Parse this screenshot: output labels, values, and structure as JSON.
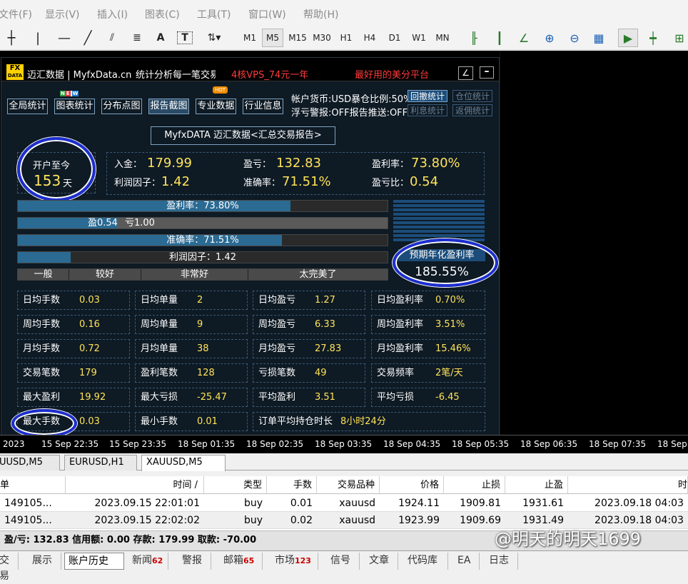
{
  "menu": [
    "文件(F)",
    "显示(V)",
    "插入(I)",
    "图表(C)",
    "工具(T)",
    "窗口(W)",
    "帮助(H)"
  ],
  "timeframes": [
    "M1",
    "M5",
    "M15",
    "M30",
    "H1",
    "H4",
    "D1",
    "W1",
    "MN"
  ],
  "panel": {
    "title": "迈汇数据 | MyfxData.cn",
    "subtitle": "统计分析每一笔交易",
    "promo1": "4核VPS_74元一年",
    "promo2": "最好用的美分平台",
    "logo": "FX DATA",
    "tabs": [
      "全局统计",
      "图表统计",
      "分布点图",
      "报告截图",
      "专业数据",
      "行业信息"
    ],
    "badge_new": "NEW",
    "badge_hot": "HOT",
    "info_line1": "帐户货币:USD暴仓比例:50%",
    "info_line2": "浮亏警报:OFF报告推送:OFF",
    "buttons": [
      "回撤统计",
      "仓位统计",
      "利息统计",
      "返佣统计"
    ],
    "report_title": "MyfxDATA 迈汇数据<汇总交易报告>",
    "since_label": "开户至今",
    "since_days": "153",
    "since_unit": "天",
    "stats_top": [
      {
        "label": "入金：",
        "value": "179.99"
      },
      {
        "label": "盈亏：",
        "value": "132.83"
      },
      {
        "label": "盈利率：",
        "value": "73.80%"
      },
      {
        "label": "利润因子：",
        "value": "1.42"
      },
      {
        "label": "准确率：",
        "value": "71.51%"
      },
      {
        "label": "盈亏比：",
        "value": "0.54"
      }
    ],
    "bars": {
      "profit_rate": {
        "label": "盈利率：73.80%",
        "fill": 0.738
      },
      "winloss_win": "盈0.54",
      "winloss_loss": "亏1.00",
      "winloss_fill": 0.27,
      "accuracy": {
        "label": "准确率：71.51%",
        "fill": 0.7151
      },
      "profit_factor": {
        "label": "利润因子：1.42",
        "fill": 0.142
      }
    },
    "rating": [
      "一般",
      "较好",
      "非常好",
      "太完美了"
    ],
    "annual_label": "预期年化盈利率",
    "annual_value": "185.55%",
    "grid": [
      [
        {
          "l": "日均手数",
          "v": "0.03"
        },
        {
          "l": "日均单量",
          "v": "2"
        },
        {
          "l": "日均盈亏",
          "v": "1.27"
        },
        {
          "l": "日均盈利率",
          "v": "0.70%"
        }
      ],
      [
        {
          "l": "周均手数",
          "v": "0.16"
        },
        {
          "l": "周均单量",
          "v": "9"
        },
        {
          "l": "周均盈亏",
          "v": "6.33"
        },
        {
          "l": "周均盈利率",
          "v": "3.51%"
        }
      ],
      [
        {
          "l": "月均手数",
          "v": "0.72"
        },
        {
          "l": "月均单量",
          "v": "38"
        },
        {
          "l": "月均盈亏",
          "v": "27.83"
        },
        {
          "l": "月均盈利率",
          "v": "15.46%"
        }
      ],
      [
        {
          "l": "交易笔数",
          "v": "179"
        },
        {
          "l": "盈利笔数",
          "v": "128"
        },
        {
          "l": "亏损笔数",
          "v": "49"
        },
        {
          "l": "交易频率",
          "v": "2笔/天"
        }
      ],
      [
        {
          "l": "最大盈利",
          "v": "19.92"
        },
        {
          "l": "最大亏损",
          "v": "-25.47"
        },
        {
          "l": "平均盈利",
          "v": "3.51"
        },
        {
          "l": "平均亏损",
          "v": "-6.45"
        }
      ]
    ],
    "last_row": [
      {
        "l": "最大手数",
        "v": "0.03"
      },
      {
        "l": "最小手数",
        "v": "0.01"
      },
      {
        "l": "订单平均持仓时长",
        "v": "8小时24分"
      }
    ]
  },
  "time_axis": [
    "2023",
    "15 Sep 22:35",
    "15 Sep 23:35",
    "18 Sep 01:35",
    "18 Sep 02:35",
    "18 Sep 03:35",
    "18 Sep 04:35",
    "18 Sep 05:35",
    "18 Sep 06:35",
    "18 Sep 07:35",
    "18 Sep"
  ],
  "symbol_tabs": [
    "UUSD,M5",
    "EURUSD,H1",
    "XAUUSD,M5"
  ],
  "table": {
    "headers": [
      "单",
      "时间 /",
      "类型",
      "手数",
      "交易品种",
      "价格",
      "止损",
      "止盈",
      "时"
    ],
    "rows": [
      [
        "149105...",
        "2023.09.15 22:01:01",
        "buy",
        "0.01",
        "xauusd",
        "1924.11",
        "1909.81",
        "1931.61",
        "2023.09.18 04:03"
      ],
      [
        "149105...",
        "2023.09.15 22:02:02",
        "buy",
        "0.02",
        "xauusd",
        "1923.99",
        "1909.69",
        "1931.49",
        "2023.09.18 04:03"
      ]
    ]
  },
  "summary": "盈/亏: 132.83  信用额: 0.00  存款: 179.99  取款: -70.00",
  "bottom_tabs": [
    {
      "label": "交易",
      "count": ""
    },
    {
      "label": "展示",
      "count": ""
    },
    {
      "label": "账户历史",
      "count": ""
    },
    {
      "label": "新闻",
      "count": "62"
    },
    {
      "label": "警报",
      "count": ""
    },
    {
      "label": "邮箱",
      "count": "65"
    },
    {
      "label": "市场",
      "count": "123"
    },
    {
      "label": "信号",
      "count": ""
    },
    {
      "label": "文章",
      "count": ""
    },
    {
      "label": "代码库",
      "count": ""
    },
    {
      "label": "EA",
      "count": ""
    },
    {
      "label": "日志",
      "count": ""
    }
  ],
  "watermark": "@明天的明天1699",
  "colors": {
    "accent_yellow": "#ffe35a",
    "ring_blue": "#1d2fd0",
    "bar_fill": "#2b6a92",
    "panel_bg": "#0e1a24"
  }
}
